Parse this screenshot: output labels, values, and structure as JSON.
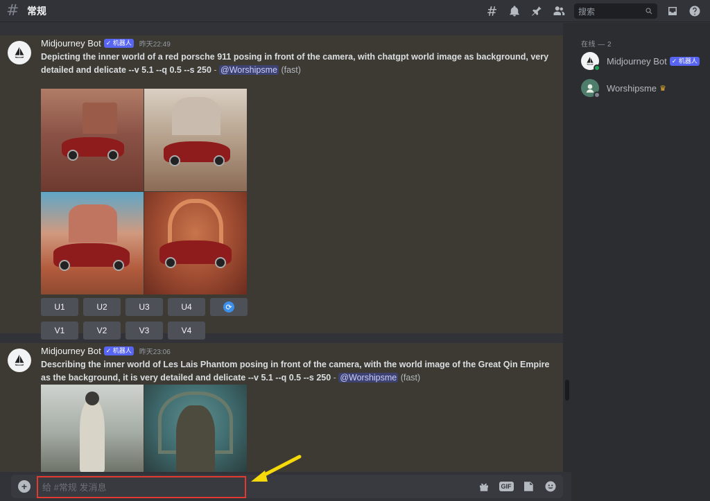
{
  "header": {
    "title": "常规",
    "search_placeholder": "搜索"
  },
  "messages": [
    {
      "author": "Midjourney Bot",
      "bot_tag": "✓ 机器人",
      "timestamp": "昨天22:49",
      "prompt": "Depicting the inner world of a red porsche 911 posing in front of the camera, with chatgpt world image as background, very detailed and delicate --v 5.1 --q 0.5 --s 250",
      "separator": " - ",
      "mention": "@Worshipsme",
      "mode": "(fast)",
      "buttons_u": [
        "U1",
        "U2",
        "U3",
        "U4"
      ],
      "buttons_v": [
        "V1",
        "V2",
        "V3",
        "V4"
      ],
      "reroll_icon": "refresh-icon"
    },
    {
      "author": "Midjourney Bot",
      "bot_tag": "✓ 机器人",
      "timestamp": "昨天23:06",
      "prompt": "Describing the inner world of Les Lais Phantom posing in front of the camera, with the world image of the Great Qin Empire as the background, it is very detailed and delicate --v 5.1 --q 0.5 --s 250",
      "separator": " - ",
      "mention": "@Worshipsme",
      "mode": "(fast)"
    }
  ],
  "members": {
    "heading": "在线 — 2",
    "list": [
      {
        "name": "Midjourney Bot",
        "tag": "✓ 机器人",
        "status": "online"
      },
      {
        "name": "Worshipsme",
        "badge": "♛",
        "status": "idle"
      }
    ]
  },
  "composer": {
    "placeholder": "给 #常规 发消息",
    "gif_label": "GIF"
  },
  "colors": {
    "accent": "#5865f2",
    "highlight_border": "#e23a2e",
    "annotation_arrow": "#f5d90a"
  }
}
